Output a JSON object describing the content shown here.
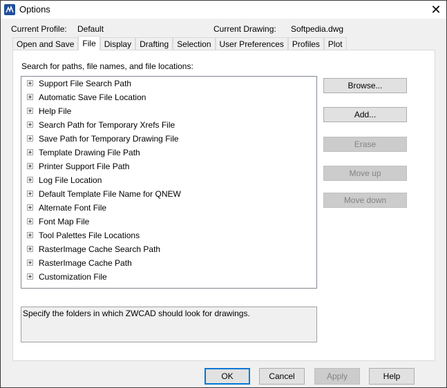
{
  "window": {
    "title": "Options",
    "close_label": "✕"
  },
  "header": {
    "current_profile_label": "Current Profile:",
    "current_profile_value": "Default",
    "current_drawing_label": "Current Drawing:",
    "current_drawing_value": "Softpedia.dwg"
  },
  "tabs": [
    {
      "label": "Open and Save"
    },
    {
      "label": "File",
      "active": true
    },
    {
      "label": "Display"
    },
    {
      "label": "Drafting"
    },
    {
      "label": "Selection"
    },
    {
      "label": "User Preferences"
    },
    {
      "label": "Profiles"
    },
    {
      "label": "Plot"
    }
  ],
  "file_tab": {
    "section_label": "Search for paths, file names, and file locations:",
    "tree_items": [
      {
        "label": "Support File Search Path"
      },
      {
        "label": "Automatic Save File Location"
      },
      {
        "label": "Help File"
      },
      {
        "label": "Search Path for Temporary Xrefs File"
      },
      {
        "label": "Save Path for Temporary Drawing File"
      },
      {
        "label": "Template Drawing File Path"
      },
      {
        "label": "Printer Support File Path"
      },
      {
        "label": "Log File Location"
      },
      {
        "label": "Default Template File Name for QNEW"
      },
      {
        "label": "Alternate Font File"
      },
      {
        "label": "Font Map File"
      },
      {
        "label": "Tool Palettes File Locations"
      },
      {
        "label": "RasterImage Cache Search Path"
      },
      {
        "label": "RasterImage Cache Path"
      },
      {
        "label": "Customization File"
      }
    ],
    "buttons": {
      "browse": "Browse...",
      "add": "Add...",
      "erase": "Erase",
      "move_up": "Move up",
      "move_down": "Move down"
    },
    "description": "Specify the folders in which ZWCAD should look for drawings."
  },
  "footer": {
    "ok": "OK",
    "cancel": "Cancel",
    "apply": "Apply",
    "help": "Help"
  }
}
